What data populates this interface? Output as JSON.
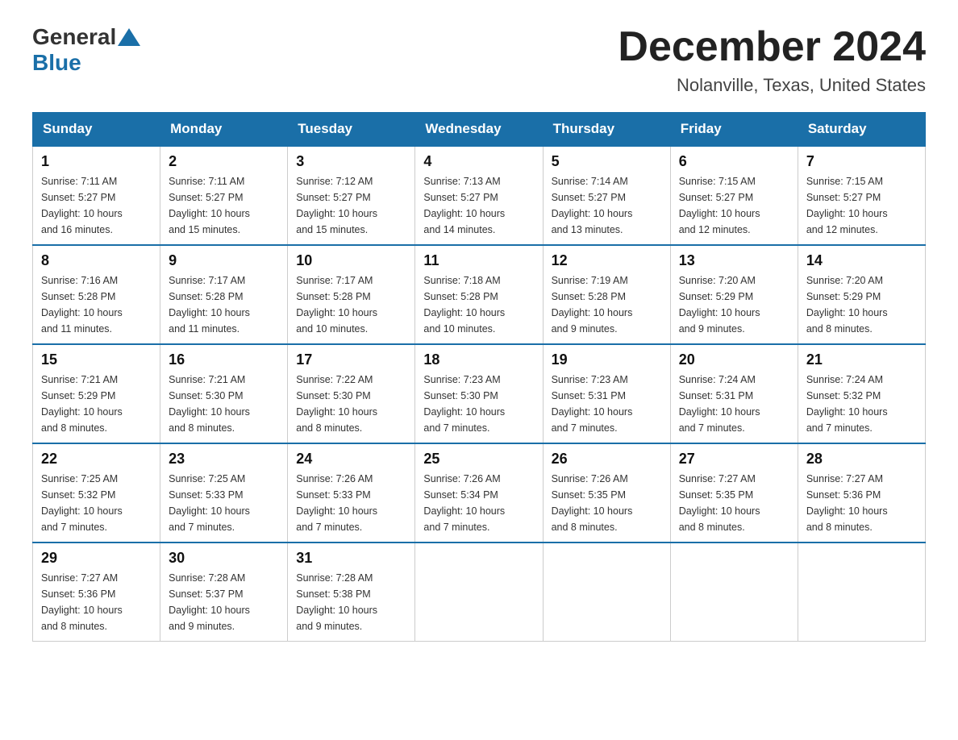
{
  "header": {
    "logo_text_general": "General",
    "logo_text_blue": "Blue",
    "month_title": "December 2024",
    "location": "Nolanville, Texas, United States"
  },
  "weekdays": [
    "Sunday",
    "Monday",
    "Tuesday",
    "Wednesday",
    "Thursday",
    "Friday",
    "Saturday"
  ],
  "weeks": [
    [
      {
        "day": "1",
        "sunrise": "7:11 AM",
        "sunset": "5:27 PM",
        "daylight": "10 hours and 16 minutes."
      },
      {
        "day": "2",
        "sunrise": "7:11 AM",
        "sunset": "5:27 PM",
        "daylight": "10 hours and 15 minutes."
      },
      {
        "day": "3",
        "sunrise": "7:12 AM",
        "sunset": "5:27 PM",
        "daylight": "10 hours and 15 minutes."
      },
      {
        "day": "4",
        "sunrise": "7:13 AM",
        "sunset": "5:27 PM",
        "daylight": "10 hours and 14 minutes."
      },
      {
        "day": "5",
        "sunrise": "7:14 AM",
        "sunset": "5:27 PM",
        "daylight": "10 hours and 13 minutes."
      },
      {
        "day": "6",
        "sunrise": "7:15 AM",
        "sunset": "5:27 PM",
        "daylight": "10 hours and 12 minutes."
      },
      {
        "day": "7",
        "sunrise": "7:15 AM",
        "sunset": "5:27 PM",
        "daylight": "10 hours and 12 minutes."
      }
    ],
    [
      {
        "day": "8",
        "sunrise": "7:16 AM",
        "sunset": "5:28 PM",
        "daylight": "10 hours and 11 minutes."
      },
      {
        "day": "9",
        "sunrise": "7:17 AM",
        "sunset": "5:28 PM",
        "daylight": "10 hours and 11 minutes."
      },
      {
        "day": "10",
        "sunrise": "7:17 AM",
        "sunset": "5:28 PM",
        "daylight": "10 hours and 10 minutes."
      },
      {
        "day": "11",
        "sunrise": "7:18 AM",
        "sunset": "5:28 PM",
        "daylight": "10 hours and 10 minutes."
      },
      {
        "day": "12",
        "sunrise": "7:19 AM",
        "sunset": "5:28 PM",
        "daylight": "10 hours and 9 minutes."
      },
      {
        "day": "13",
        "sunrise": "7:20 AM",
        "sunset": "5:29 PM",
        "daylight": "10 hours and 9 minutes."
      },
      {
        "day": "14",
        "sunrise": "7:20 AM",
        "sunset": "5:29 PM",
        "daylight": "10 hours and 8 minutes."
      }
    ],
    [
      {
        "day": "15",
        "sunrise": "7:21 AM",
        "sunset": "5:29 PM",
        "daylight": "10 hours and 8 minutes."
      },
      {
        "day": "16",
        "sunrise": "7:21 AM",
        "sunset": "5:30 PM",
        "daylight": "10 hours and 8 minutes."
      },
      {
        "day": "17",
        "sunrise": "7:22 AM",
        "sunset": "5:30 PM",
        "daylight": "10 hours and 8 minutes."
      },
      {
        "day": "18",
        "sunrise": "7:23 AM",
        "sunset": "5:30 PM",
        "daylight": "10 hours and 7 minutes."
      },
      {
        "day": "19",
        "sunrise": "7:23 AM",
        "sunset": "5:31 PM",
        "daylight": "10 hours and 7 minutes."
      },
      {
        "day": "20",
        "sunrise": "7:24 AM",
        "sunset": "5:31 PM",
        "daylight": "10 hours and 7 minutes."
      },
      {
        "day": "21",
        "sunrise": "7:24 AM",
        "sunset": "5:32 PM",
        "daylight": "10 hours and 7 minutes."
      }
    ],
    [
      {
        "day": "22",
        "sunrise": "7:25 AM",
        "sunset": "5:32 PM",
        "daylight": "10 hours and 7 minutes."
      },
      {
        "day": "23",
        "sunrise": "7:25 AM",
        "sunset": "5:33 PM",
        "daylight": "10 hours and 7 minutes."
      },
      {
        "day": "24",
        "sunrise": "7:26 AM",
        "sunset": "5:33 PM",
        "daylight": "10 hours and 7 minutes."
      },
      {
        "day": "25",
        "sunrise": "7:26 AM",
        "sunset": "5:34 PM",
        "daylight": "10 hours and 7 minutes."
      },
      {
        "day": "26",
        "sunrise": "7:26 AM",
        "sunset": "5:35 PM",
        "daylight": "10 hours and 8 minutes."
      },
      {
        "day": "27",
        "sunrise": "7:27 AM",
        "sunset": "5:35 PM",
        "daylight": "10 hours and 8 minutes."
      },
      {
        "day": "28",
        "sunrise": "7:27 AM",
        "sunset": "5:36 PM",
        "daylight": "10 hours and 8 minutes."
      }
    ],
    [
      {
        "day": "29",
        "sunrise": "7:27 AM",
        "sunset": "5:36 PM",
        "daylight": "10 hours and 8 minutes."
      },
      {
        "day": "30",
        "sunrise": "7:28 AM",
        "sunset": "5:37 PM",
        "daylight": "10 hours and 9 minutes."
      },
      {
        "day": "31",
        "sunrise": "7:28 AM",
        "sunset": "5:38 PM",
        "daylight": "10 hours and 9 minutes."
      },
      null,
      null,
      null,
      null
    ]
  ],
  "labels": {
    "sunrise": "Sunrise:",
    "sunset": "Sunset:",
    "daylight": "Daylight:"
  }
}
